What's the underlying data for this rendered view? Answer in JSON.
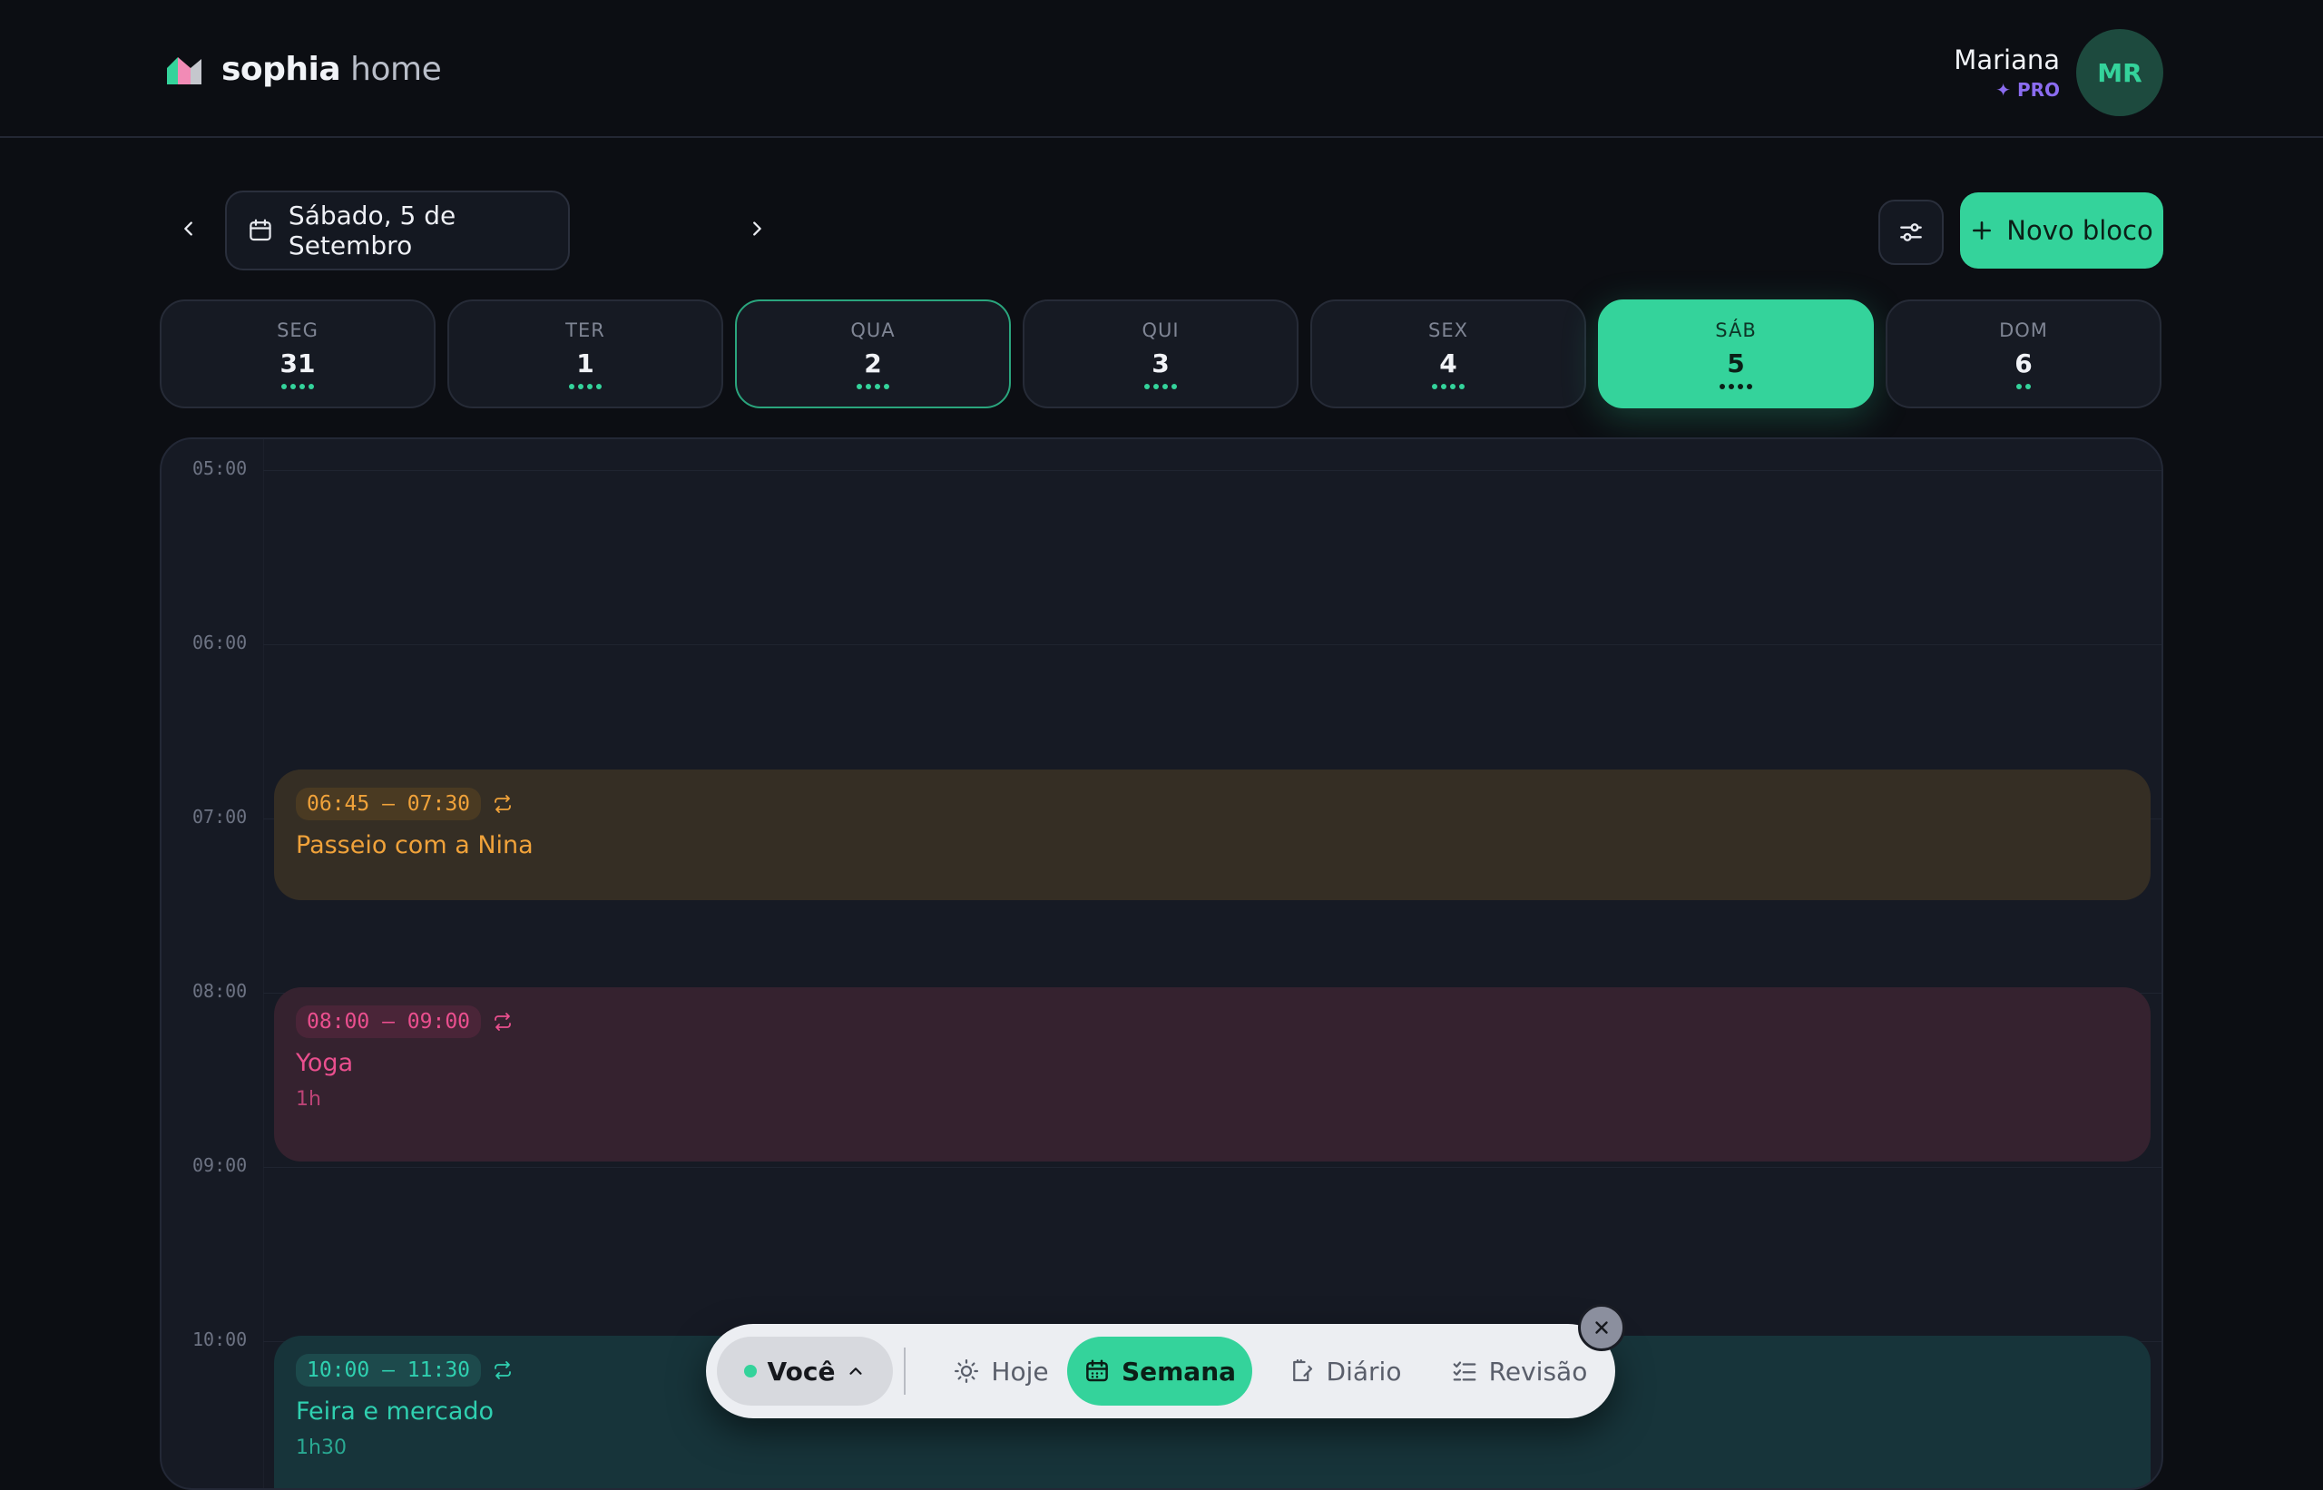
{
  "brand": {
    "name_bold": "sophia",
    "name_light": "home"
  },
  "user": {
    "name": "Mariana",
    "plan": "✦ PRO",
    "initials": "MR"
  },
  "toolbar": {
    "date_label": "Sábado, 5 de Setembro",
    "new_button": "Novo bloco"
  },
  "week": [
    {
      "name": "SEG",
      "num": "31",
      "dots": 4
    },
    {
      "name": "TER",
      "num": "1",
      "dots": 4
    },
    {
      "name": "QUA",
      "num": "2",
      "dots": 4
    },
    {
      "name": "QUI",
      "num": "3",
      "dots": 4
    },
    {
      "name": "SEX",
      "num": "4",
      "dots": 4
    },
    {
      "name": "SÁB",
      "num": "5",
      "dots": 4
    },
    {
      "name": "DOM",
      "num": "6",
      "dots": 2
    }
  ],
  "hours": [
    "05:00",
    "06:00",
    "07:00",
    "08:00",
    "09:00",
    "10:00"
  ],
  "events": [
    {
      "time": "06:45 – 07:30",
      "title": "Passeio com a Nina",
      "duration": ""
    },
    {
      "time": "08:00 – 09:00",
      "title": "Yoga",
      "duration": "1h"
    },
    {
      "time": "10:00 – 11:30",
      "title": "Feira e mercado",
      "duration": "1h30"
    }
  ],
  "bottom_nav": {
    "you": "Você",
    "hoje": "Hoje",
    "semana": "Semana",
    "diario": "Diário",
    "revisao": "Revisão"
  },
  "colors": {
    "accent": "#34d39b",
    "amber": "#f0a23a",
    "pink": "#ea4f8e",
    "teal": "#2fd0b0"
  }
}
